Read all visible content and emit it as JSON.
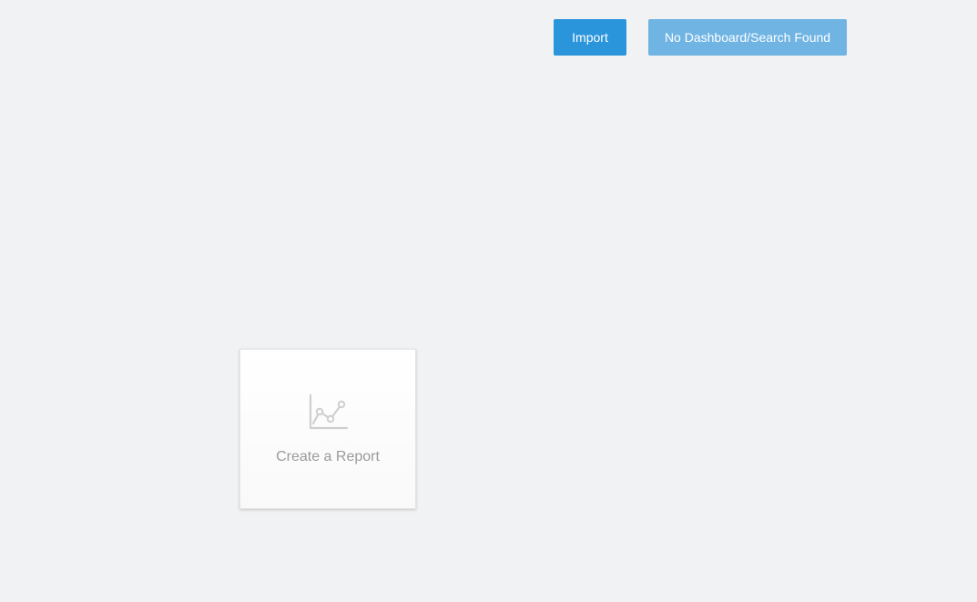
{
  "toolbar": {
    "import_label": "Import",
    "no_dashboard_label": "No Dashboard/Search Found"
  },
  "report_card": {
    "label": "Create a Report",
    "icon": "line-chart-icon"
  },
  "colors": {
    "background": "#f1f2f4",
    "primary_button": "#2b95db",
    "disabled_button": "#6fb4e3",
    "card_text": "#9a9a9a",
    "icon_stroke": "#cfcfcf"
  }
}
